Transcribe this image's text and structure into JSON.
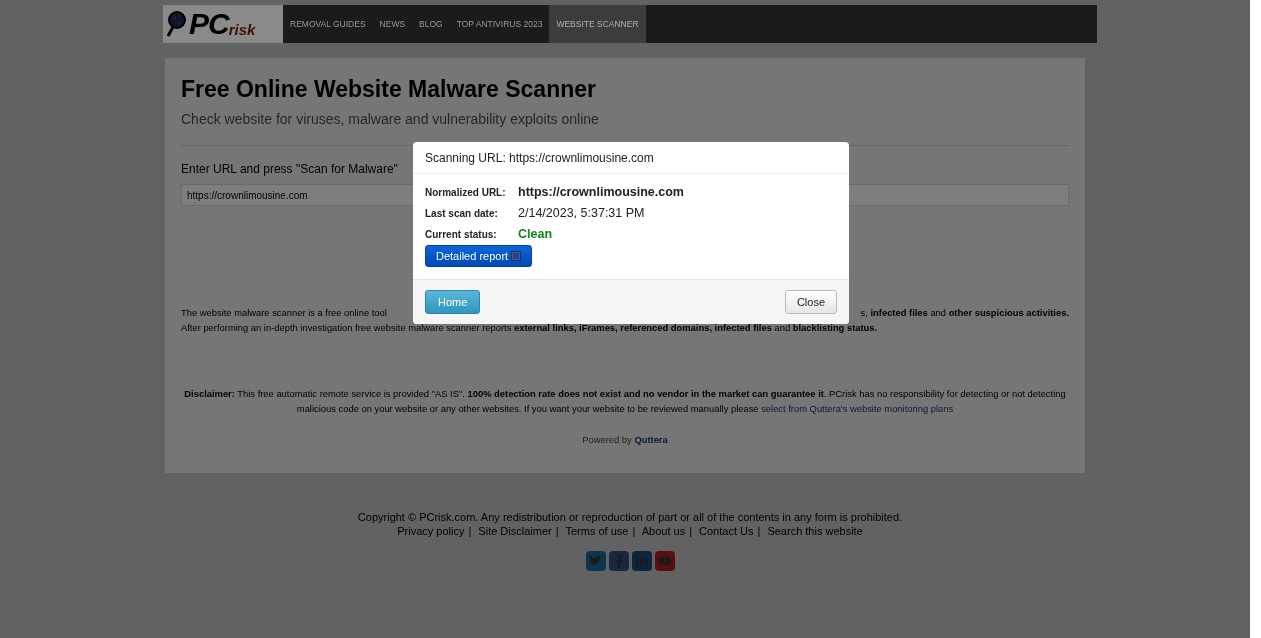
{
  "header": {
    "logo": {
      "main": "PC",
      "sub": "risk"
    },
    "nav": [
      {
        "label": "REMOVAL GUIDES",
        "selected": false
      },
      {
        "label": "NEWS",
        "selected": false
      },
      {
        "label": "BLOG",
        "selected": false
      },
      {
        "label": "TOP ANTIVIRUS 2023",
        "selected": false
      },
      {
        "label": "WEBSITE SCANNER",
        "selected": true
      }
    ]
  },
  "scanner": {
    "title": "Free Online Website Malware Scanner",
    "subtitle": "Check website for viruses, malware and vulnerability exploits online",
    "url_label": "Enter URL and press \"Scan for Malware\"",
    "url_value": "https://crownlimousine.com",
    "about_left": "The website malware scanner is a free online tool",
    "about_right": "s, **infected files** and **other suspicious activities.**",
    "about_line2": "After performing an in-depth investigation free website malware scanner reports **external links, iFrames, referenced domains, infected files** and **blacklisting status.**",
    "disclaimer": "**Disclaimer:** This free automatic remote service is provided \"AS IS\". **100% detection rate does not exist and no vendor in the market can guarantee it**. PCrisk has no responsibility for detecting or not detecting malicious code on your website or any other websites. If you want your website to be reviewed manually please",
    "disclaimer_link": "select from Quttera's website monitoring plans",
    "powered_by": "Powered by",
    "powered_link": "Quttera"
  },
  "modal": {
    "title": "Scanning URL: https://crownlimousine.com",
    "fields": [
      {
        "label": "Normalized URL:",
        "value": "https://crownlimousine.com",
        "kind": "url"
      },
      {
        "label": "Last scan date:",
        "value": "2/14/2023, 5:37:31 PM",
        "kind": "date"
      },
      {
        "label": "Current status:",
        "value": "Clean",
        "kind": "status"
      }
    ],
    "report_button": "Detailed report",
    "home_button": "Home",
    "close_button": "Close"
  },
  "footer": {
    "copyright": "Copyright © PCrisk.com. Any redistribution or reproduction of part or all of the contents in any form is prohibited.",
    "separator": "|",
    "links": [
      "Privacy policy",
      "Site Disclaimer",
      "Terms of use",
      "About us",
      "Contact Us",
      "Search this website"
    ],
    "social": [
      {
        "kind": "twitter"
      },
      {
        "kind": "facebook"
      },
      {
        "kind": "linkedin"
      },
      {
        "kind": "youtube"
      }
    ]
  }
}
